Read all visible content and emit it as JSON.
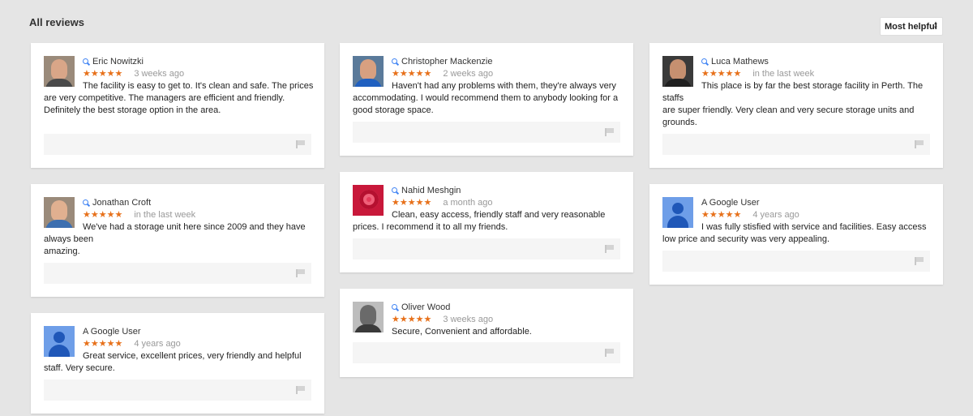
{
  "header": {
    "title": "All reviews",
    "sort_label": "Most helpful"
  },
  "reviews": [
    {
      "name": "Eric Nowitzki",
      "stars": "★★★★★",
      "time": "3 weeks ago",
      "lines": [
        "The facility is easy to get to. It's clean and safe. The prices",
        "are very competitive. The managers are efficient and friendly.",
        "Definitely the best storage option in the area."
      ]
    },
    {
      "name": "Jonathan Croft",
      "stars": "★★★★★",
      "time": "in the last week",
      "lines": [
        "We've had a storage unit here since 2009 and they have",
        "always been",
        "amazing."
      ]
    },
    {
      "name": "A Google User",
      "stars": "★★★★★",
      "time": "4 years ago",
      "lines": [
        "Great service, excellent prices, very friendly and helpful",
        "staff. Very secure."
      ]
    },
    {
      "name": "Christopher Mackenzie",
      "stars": "★★★★★",
      "time": "2 weeks ago",
      "lines": [
        "Haven't had any problems with them, they're always very",
        "accommodating. I would recommend them to anybody looking for a",
        "good storage space."
      ]
    },
    {
      "name": "Nahid Meshgin",
      "stars": "★★★★★",
      "time": "a month ago",
      "lines": [
        "Clean, easy access, friendly staff and very reasonable",
        "prices. I recommend it to all my friends."
      ]
    },
    {
      "name": "Oliver Wood",
      "stars": "★★★★★",
      "time": "3 weeks ago",
      "lines": [
        "Secure, Convenient and affordable."
      ]
    },
    {
      "name": "Luca Mathews",
      "stars": "★★★★★",
      "time": "in the last week",
      "lines": [
        "This place is by far the best storage facility in Perth. The",
        "staffs",
        "are super friendly. Very clean and very secure storage units and",
        "grounds."
      ]
    },
    {
      "name": "A Google User",
      "stars": "★★★★★",
      "time": "4 years ago",
      "lines": [
        "I was fully stisfied with service and facilities. Easy access",
        "low price and security was very appealing."
      ]
    }
  ],
  "icons": {
    "search": "search-icon",
    "flag": "flag-icon",
    "sort": "sort-arrows-icon"
  },
  "colors": {
    "star": "#e7711b",
    "search": "#4285f4",
    "background": "#e5e5e5"
  }
}
